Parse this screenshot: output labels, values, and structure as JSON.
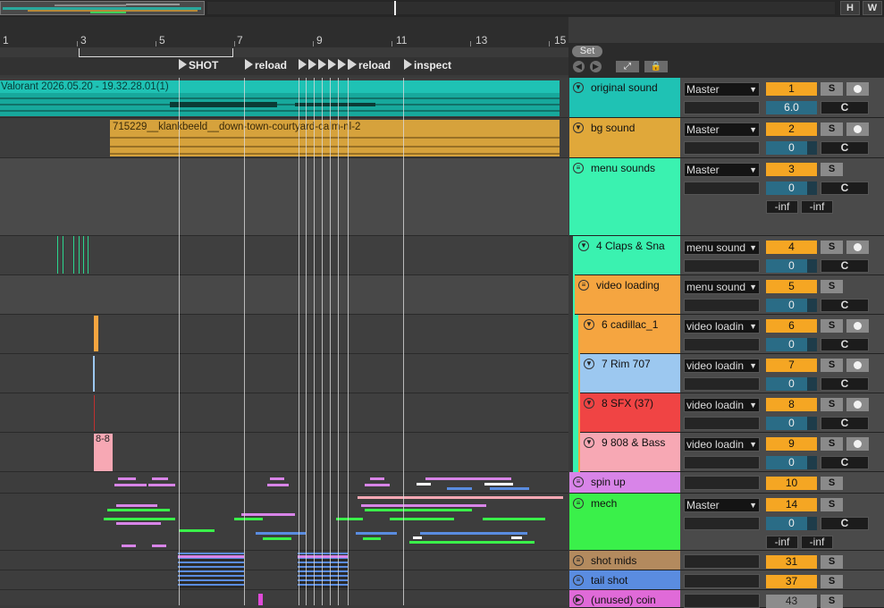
{
  "overview": {
    "h_label": "H",
    "w_label": "W"
  },
  "ruler": {
    "bars": [
      "1",
      "3",
      "5",
      "7",
      "9",
      "11",
      "13",
      "15"
    ]
  },
  "locators": [
    "SHOT",
    "reload",
    "reload",
    "inspect"
  ],
  "header": {
    "set_label": "Set"
  },
  "clips": {
    "video": "Valorant 2026.05.20 - 19.32.28.01(1)",
    "bg": "715229__klankbeeld__down-town-courtyard-calm-nl-2",
    "bass": "8-8"
  },
  "tracks": [
    {
      "name": "original sound",
      "color": "#1fc2b4",
      "routing": "Master",
      "num": "1",
      "vol": "6.0",
      "pan": "C",
      "arm": true
    },
    {
      "name": "bg sound",
      "color": "#e0a83a",
      "routing": "Master",
      "num": "2",
      "vol": "0",
      "pan": "C",
      "arm": true
    },
    {
      "name": "menu sounds",
      "color": "#3af2b0",
      "routing": "Master",
      "num": "3",
      "vol": "0",
      "pan": "C",
      "inf_l": "-inf",
      "inf_r": "-inf"
    },
    {
      "name": "4 Claps & Sna",
      "color": "#3af2b0",
      "routing": "menu sound",
      "num": "4",
      "vol": "0",
      "pan": "C",
      "arm": true
    },
    {
      "name": "video loading",
      "color": "#f5a540",
      "routing": "menu sound",
      "num": "5",
      "vol": "0",
      "pan": "C"
    },
    {
      "name": "6 cadillac_1",
      "color": "#f5a540",
      "routing": "video loadin",
      "num": "6",
      "vol": "0",
      "pan": "C",
      "arm": true
    },
    {
      "name": "7 Rim 707",
      "color": "#9cc8f0",
      "routing": "video loadin",
      "num": "7",
      "vol": "0",
      "pan": "C",
      "arm": true
    },
    {
      "name": "8 SFX (37)",
      "color": "#f04444",
      "routing": "video loadin",
      "num": "8",
      "vol": "0",
      "pan": "C",
      "arm": true
    },
    {
      "name": "9 808 & Bass",
      "color": "#f7a8b4",
      "routing": "video loadin",
      "num": "9",
      "vol": "0",
      "pan": "C",
      "arm": true
    },
    {
      "name": "spin up",
      "color": "#d884e8",
      "num": "10"
    },
    {
      "name": "mech",
      "color": "#3af04a",
      "routing": "Master",
      "num": "14",
      "vol": "0",
      "pan": "C",
      "inf_l": "-inf",
      "inf_r": "-inf"
    },
    {
      "name": "shot mids",
      "color": "#b38a5e",
      "num": "31"
    },
    {
      "name": "tail shot",
      "color": "#5a8ce0",
      "num": "37"
    },
    {
      "name": "(unused) coin",
      "color": "#e06ad8",
      "num": "43"
    }
  ],
  "solo_label": "S"
}
